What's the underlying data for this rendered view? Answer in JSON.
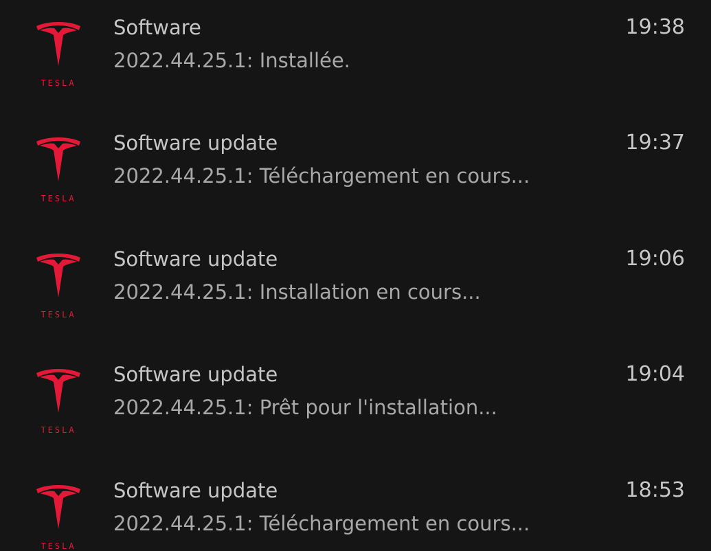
{
  "brand": {
    "name": "TESLA",
    "icon": "tesla-logo-icon",
    "color": "#e31937"
  },
  "notifications": [
    {
      "title": "Software",
      "body": "2022.44.25.1: Installée.",
      "time": "19:38"
    },
    {
      "title": "Software update",
      "body": "2022.44.25.1: Téléchargement en cours...",
      "time": "19:37"
    },
    {
      "title": "Software update",
      "body": "2022.44.25.1: Installation en cours...",
      "time": "19:06"
    },
    {
      "title": "Software update",
      "body": "2022.44.25.1: Prêt pour l'installation...",
      "time": "19:04"
    },
    {
      "title": "Software update",
      "body": "2022.44.25.1: Téléchargement en cours...",
      "time": "18:53"
    }
  ]
}
